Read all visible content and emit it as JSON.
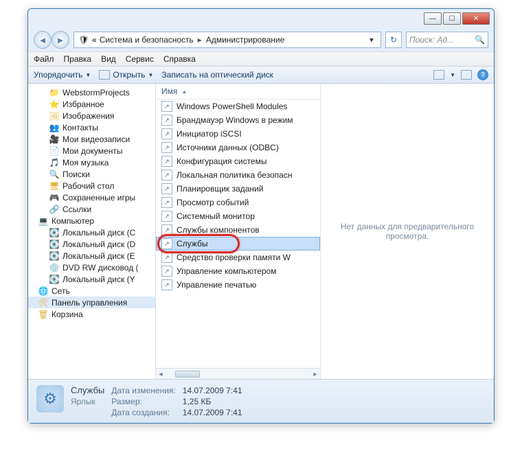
{
  "breadcrumb": {
    "shield": "🛡",
    "part1": "Система и безопасность",
    "part2": "Администрирование"
  },
  "search": {
    "placeholder": "Поиск: Ад..."
  },
  "menu": {
    "file": "Файл",
    "edit": "Правка",
    "view": "Вид",
    "tools": "Сервис",
    "help": "Справка"
  },
  "toolbar": {
    "organize": "Упорядочить",
    "open": "Открыть",
    "burn": "Записать на оптический диск"
  },
  "tree": [
    {
      "icon": "📁",
      "label": "WebstormProjects",
      "indent": "indent2"
    },
    {
      "icon": "⭐",
      "label": "Избранное",
      "indent": "indent2"
    },
    {
      "icon": "🖼",
      "label": "Изображения",
      "indent": "indent2"
    },
    {
      "icon": "👥",
      "label": "Контакты",
      "indent": "indent2"
    },
    {
      "icon": "🎥",
      "label": "Мои видеозаписи",
      "indent": "indent2"
    },
    {
      "icon": "📄",
      "label": "Мои документы",
      "indent": "indent2"
    },
    {
      "icon": "🎵",
      "label": "Моя музыка",
      "indent": "indent2"
    },
    {
      "icon": "🔍",
      "label": "Поиски",
      "indent": "indent2"
    },
    {
      "icon": "🖥",
      "label": "Рабочий стол",
      "indent": "indent2"
    },
    {
      "icon": "🎮",
      "label": "Сохраненные игры",
      "indent": "indent2"
    },
    {
      "icon": "🔗",
      "label": "Ссылки",
      "indent": "indent2"
    },
    {
      "icon": "💻",
      "label": "Компьютер",
      "indent": "indent1"
    },
    {
      "icon": "💽",
      "label": "Локальный диск (C",
      "indent": "indent2",
      "drive": true
    },
    {
      "icon": "💽",
      "label": "Локальный диск (D",
      "indent": "indent2",
      "drive": true
    },
    {
      "icon": "💽",
      "label": "Локальный диск (E",
      "indent": "indent2",
      "drive": true
    },
    {
      "icon": "💿",
      "label": "DVD RW дисковод (",
      "indent": "indent2",
      "drive": true
    },
    {
      "icon": "💽",
      "label": "Локальный диск (Y",
      "indent": "indent2",
      "drive": true
    },
    {
      "icon": "🌐",
      "label": "Сеть",
      "indent": "indent1"
    },
    {
      "icon": "🛠",
      "label": "Панель управления",
      "indent": "indent1",
      "sel": true
    },
    {
      "icon": "🗑",
      "label": "Корзина",
      "indent": "indent1"
    }
  ],
  "column_header": "Имя",
  "files": [
    {
      "label": "Windows PowerShell Modules"
    },
    {
      "label": "Брандмауэр Windows в режим"
    },
    {
      "label": "Инициатор iSCSI"
    },
    {
      "label": "Источники данных (ODBC)"
    },
    {
      "label": "Конфигурация системы"
    },
    {
      "label": "Локальная политика безопасн"
    },
    {
      "label": "Планировщик заданий"
    },
    {
      "label": "Просмотр событий"
    },
    {
      "label": "Системный монитор"
    },
    {
      "label": "Службы компонентов"
    },
    {
      "label": "Службы",
      "sel": true,
      "highlight": true
    },
    {
      "label": "Средство проверки памяти W"
    },
    {
      "label": "Управление компьютером"
    },
    {
      "label": "Управление печатью"
    }
  ],
  "preview_empty": "Нет данных для предварительного просмотра.",
  "details": {
    "name": "Службы",
    "type": "Ярлык",
    "modified_label": "Дата изменения:",
    "modified": "14.07.2009 7:41",
    "size_label": "Размер:",
    "size": "1,25 КБ",
    "created_label": "Дата создания:",
    "created": "14.07.2009 7:41"
  }
}
